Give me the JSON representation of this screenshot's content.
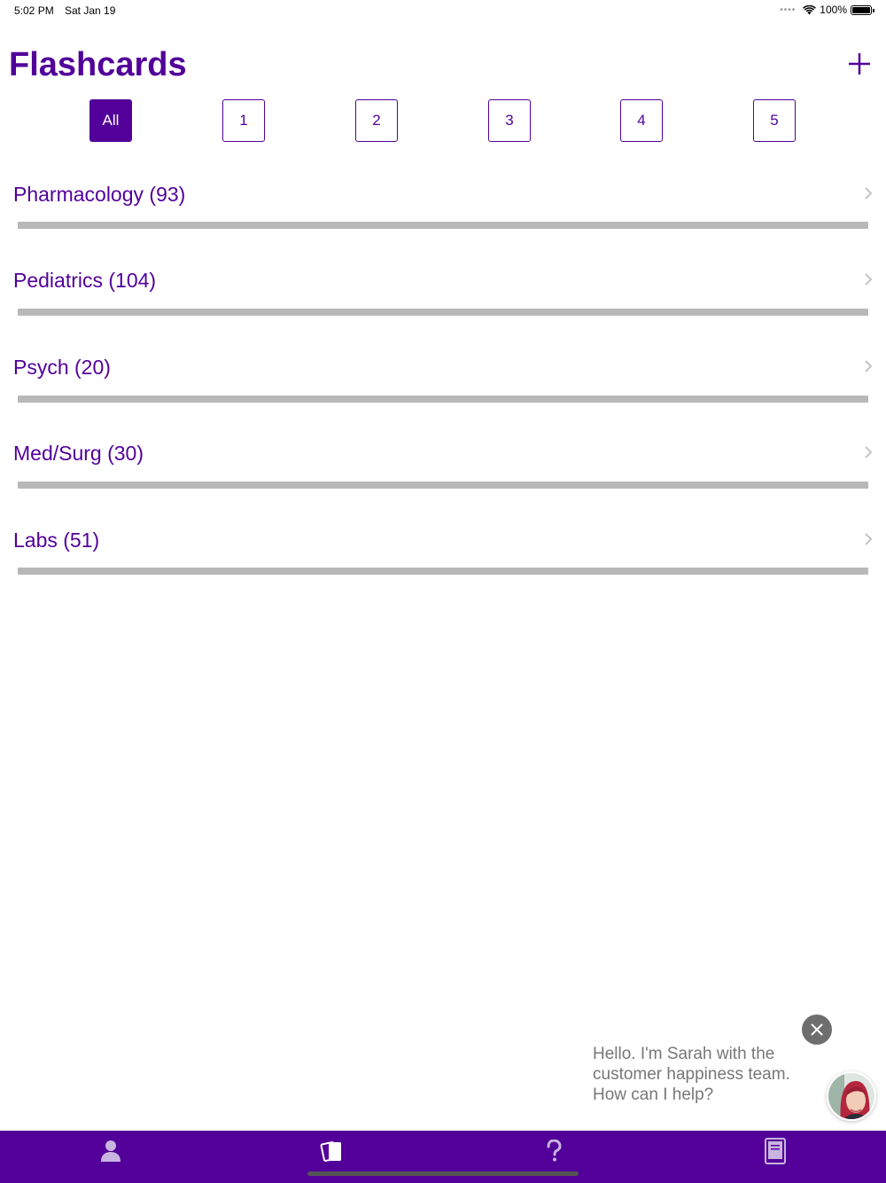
{
  "status_bar": {
    "time": "5:02 PM",
    "date": "Sat Jan 19",
    "battery": "100%",
    "icons": [
      "signal-dots-icon",
      "wifi-icon",
      "battery-icon"
    ]
  },
  "header": {
    "title": "Flashcards",
    "add_icon": "plus-icon"
  },
  "filters": [
    {
      "label": "All",
      "active": true
    },
    {
      "label": "1",
      "active": false
    },
    {
      "label": "2",
      "active": false
    },
    {
      "label": "3",
      "active": false
    },
    {
      "label": "4",
      "active": false
    },
    {
      "label": "5",
      "active": false
    }
  ],
  "decks": [
    {
      "label": "Pharmacology (93)",
      "progress": 0
    },
    {
      "label": "Pediatrics (104)",
      "progress": 0
    },
    {
      "label": "Psych (20)",
      "progress": 0
    },
    {
      "label": "Med/Surg (30)",
      "progress": 0
    },
    {
      "label": "Labs (51)",
      "progress": 0
    }
  ],
  "chat": {
    "message": "Hello. I'm Sarah with the customer happiness team. How can I help?",
    "close_icon": "close-icon",
    "avatar_icon": "support-avatar"
  },
  "tab_bar": {
    "items": [
      {
        "icon": "profile-icon",
        "active": false
      },
      {
        "icon": "flashcards-icon",
        "active": true
      },
      {
        "icon": "help-icon",
        "active": false
      },
      {
        "icon": "book-icon",
        "active": false
      }
    ]
  },
  "colors": {
    "accent": "#520099",
    "progress_track": "#b8b8b8",
    "tab_icon": "#c9b3e0"
  }
}
